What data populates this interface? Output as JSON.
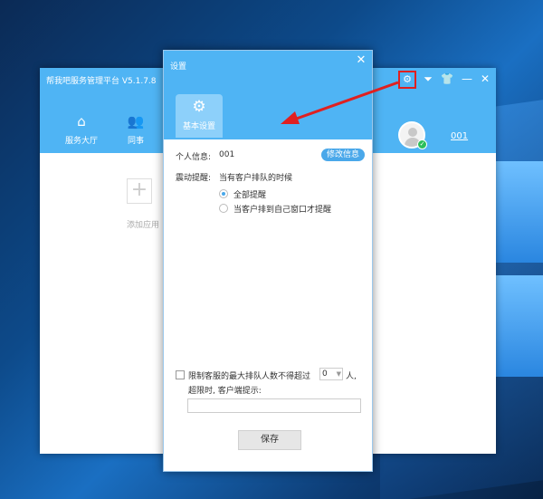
{
  "main_window": {
    "title": "帮我吧服务管理平台  V5.1.7.8",
    "nav": [
      {
        "label": "服务大厅",
        "icon": "home-icon"
      },
      {
        "label": "同事",
        "icon": "colleagues-icon"
      }
    ],
    "user_id": "001",
    "add_app_label": "添加应用",
    "controls": {
      "settings": "⚙",
      "dropdown": "⏷",
      "skin": "👕",
      "minimize": "—",
      "close": "✕"
    }
  },
  "settings_dialog": {
    "title": "设置",
    "close": "✕",
    "tab_label": "基本设置",
    "personal_info_label": "个人信息:",
    "personal_info_value": "001",
    "edit_info_button": "修改信息",
    "vibration_label": "震动提醒:",
    "vibration_desc": "当有客户排队的时候",
    "radio_options": [
      {
        "label": "全部提醒",
        "selected": true
      },
      {
        "label": "当客户排到自己窗口才提醒",
        "selected": false
      }
    ],
    "queue_limit_prefix": "限制客服的最大排队人数不得超过",
    "queue_limit_value": "0",
    "queue_limit_suffix": "人,",
    "overflow_hint_label": "超限时, 客户端提示:",
    "overflow_hint_value": "",
    "save_button": "保存"
  },
  "colors": {
    "header_blue": "#4fb4f4",
    "accent_blue": "#4aa8ea",
    "highlight_red": "#e02020",
    "online_green": "#2bbf5b"
  }
}
